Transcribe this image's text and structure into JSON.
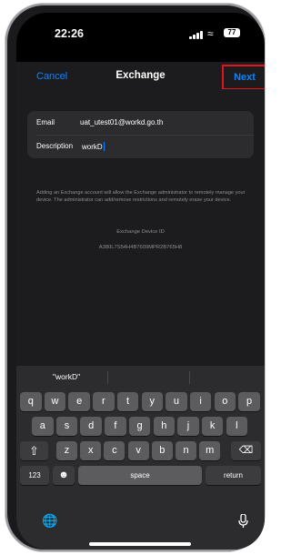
{
  "status": {
    "time": "22:26",
    "battery": "77"
  },
  "nav": {
    "cancel": "Cancel",
    "title": "Exchange",
    "next": "Next"
  },
  "form": {
    "email_label": "Email",
    "email_value": "uat_utest01@workd.go.th",
    "description_label": "Description",
    "description_value": "workD"
  },
  "info_text": "Adding an Exchange account will allow the Exchange administrator to remotely manage your device. The administrator can add/remove restrictions and remotely erase your device.",
  "device": {
    "label": "Exchange Device ID",
    "id": "A380L7S54H4B7609MPR2B765H8"
  },
  "keyboard": {
    "suggestion": "\"workD\"",
    "row1": [
      "q",
      "w",
      "e",
      "r",
      "t",
      "y",
      "u",
      "i",
      "o",
      "p"
    ],
    "row2": [
      "a",
      "s",
      "d",
      "f",
      "g",
      "h",
      "j",
      "k",
      "l"
    ],
    "row3": [
      "z",
      "x",
      "c",
      "v",
      "b",
      "n",
      "m"
    ],
    "numbers_key": "123",
    "space_key": "space",
    "return_key": "return"
  },
  "icons": {
    "shift": "shift-icon",
    "delete": "delete-icon",
    "emoji": "emoji-icon",
    "globe": "globe-icon",
    "mic": "microphone-icon",
    "wifi": "wifi-icon",
    "signal": "cellular-signal-icon"
  },
  "colors": {
    "accent": "#0a84ff",
    "highlight_box": "#e3141d"
  }
}
